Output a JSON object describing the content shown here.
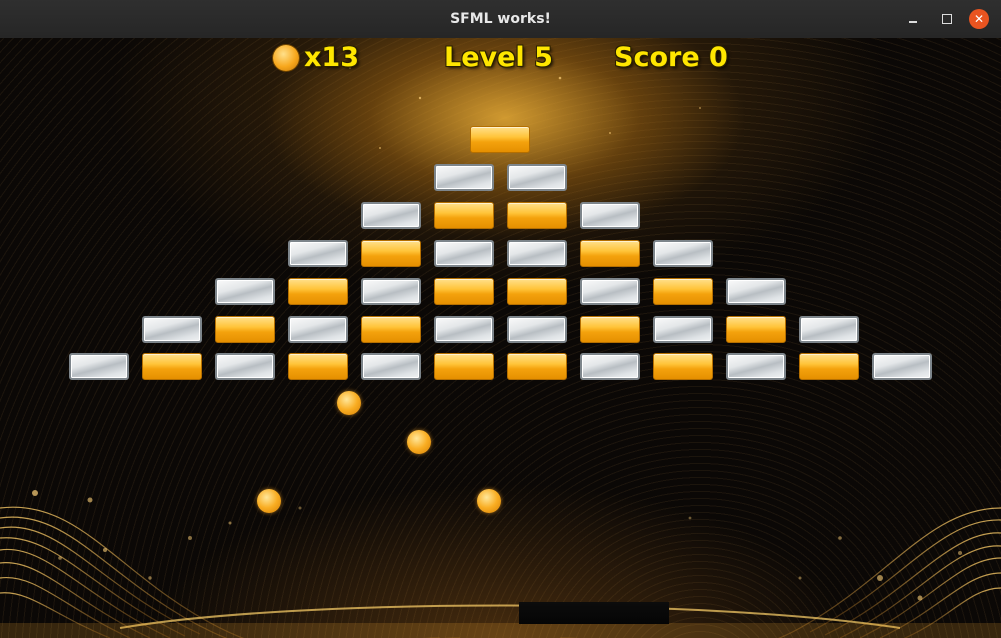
{
  "window": {
    "title": "SFML works!",
    "controls": [
      "minimize-icon",
      "maximize-icon",
      "close-icon"
    ],
    "accent_color": "#e95420"
  },
  "hud": {
    "lives": "x13",
    "level": "Level 5",
    "score": "Score 0",
    "text_color": "#ffe600"
  },
  "bricks": [
    [
      "gold"
    ],
    [
      "silver",
      "silver"
    ],
    [
      "silver",
      "gold",
      "gold",
      "silver"
    ],
    [
      "silver",
      "gold",
      "silver",
      "silver",
      "gold",
      "silver"
    ],
    [
      "silver",
      "gold",
      "silver",
      "gold",
      "gold",
      "silver",
      "gold",
      "silver"
    ],
    [
      "silver",
      "gold",
      "silver",
      "gold",
      "silver",
      "silver",
      "gold",
      "silver",
      "gold",
      "silver"
    ],
    [
      "silver",
      "gold",
      "silver",
      "gold",
      "silver",
      "gold",
      "gold",
      "silver",
      "gold",
      "silver",
      "gold",
      "silver"
    ]
  ],
  "balls_in_play": 4,
  "colors": {
    "gold_brick": "#f7b01f",
    "silver_brick": "#d8dcdf",
    "ball": "#f9ad22"
  }
}
